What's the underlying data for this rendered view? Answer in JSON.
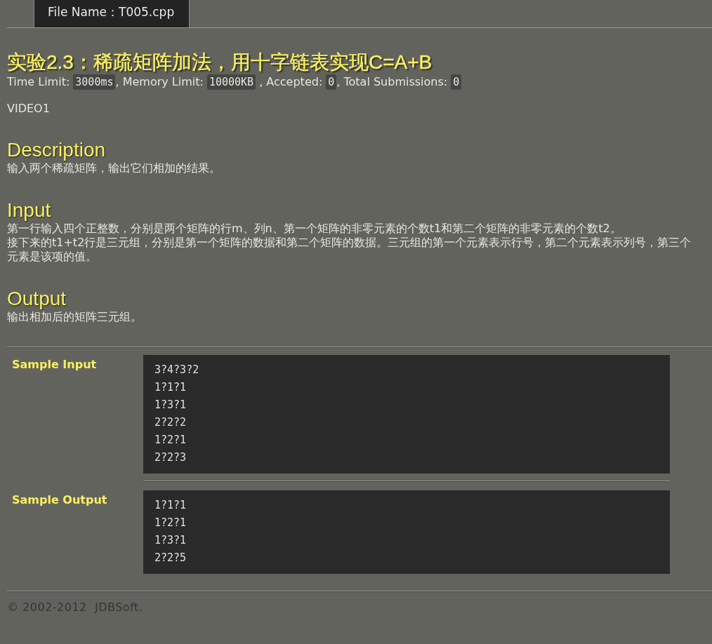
{
  "tab": {
    "label": "File Name：T005.cpp"
  },
  "title": "实验2.3：稀疏矩阵加法，用十字链表实现C=A+B",
  "limits": [
    {
      "label": "Time Limit:",
      "value": "3000ms"
    },
    {
      "label": ", Memory Limit:",
      "value": "10000KB"
    },
    {
      "label": " , Accepted:",
      "value": "0"
    },
    {
      "label": ", Total Submissions:",
      "value": "0"
    }
  ],
  "note": "VIDEO1",
  "sections": [
    {
      "heading": "Description",
      "paragraphs": [
        "输入两个稀疏矩阵，输出它们相加的结果。"
      ]
    },
    {
      "heading": "Input",
      "paragraphs": [
        "第一行输入四个正整数，分别是两个矩阵的行m、列n、第一个矩阵的非零元素的个数t1和第二个矩阵的非零元素的个数t2。",
        "接下来的t1+t2行是三元组，分别是第一个矩阵的数据和第二个矩阵的数据。三元组的第一个元素表示行号，第二个元素表示列号，第三个元素是该项的值。"
      ]
    },
    {
      "heading": "Output",
      "paragraphs": [
        "输出相加后的矩阵三元组。"
      ]
    }
  ],
  "samples": [
    {
      "label": "Sample Input",
      "lines": [
        "3?4?3?2",
        "1?1?1",
        "1?3?1",
        "2?2?2",
        "1?2?1",
        "2?2?3"
      ]
    },
    {
      "label": "Sample Output",
      "lines": [
        "1?1?1",
        "1?2?1",
        "1?3?1",
        "2?2?5"
      ]
    }
  ],
  "footer": "© 2002-2012  JDBSoft."
}
